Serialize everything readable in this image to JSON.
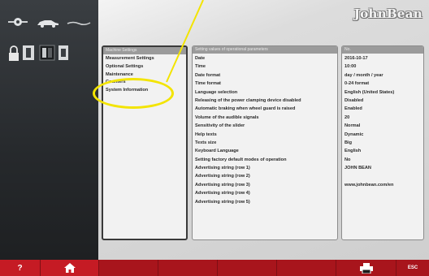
{
  "brand": {
    "logo_text": "JohnBean"
  },
  "menu": {
    "header": "Machine Settings",
    "items": [
      {
        "label": "Measurement Settings"
      },
      {
        "label": "Optional Settings"
      },
      {
        "label": "Maintenance"
      },
      {
        "label": "Counters"
      },
      {
        "label": "System Information"
      }
    ]
  },
  "params": {
    "header": "Setting values of operational parameters",
    "rows": [
      {
        "label": "Date",
        "value": "2016-10-17"
      },
      {
        "label": "Time",
        "value": "10:00"
      },
      {
        "label": "Date format",
        "value": "day / month / year"
      },
      {
        "label": "Time format",
        "value": "0-24 format"
      },
      {
        "label": "Language selection",
        "value": "English (United States)"
      },
      {
        "label": "Releasing of the power clamping device disabled",
        "value": "Disabled"
      },
      {
        "label": "Automatic braking when wheel guard is raised",
        "value": "Enabled"
      },
      {
        "label": "Volume of the audible signals",
        "value": "20"
      },
      {
        "label": "Sensitivity of the slider",
        "value": "Normal"
      },
      {
        "label": "Help texts",
        "value": "Dynamic"
      },
      {
        "label": "Texts size",
        "value": "Big"
      },
      {
        "label": "Keyboard Language",
        "value": "English"
      },
      {
        "label": "Setting factory default modes of operation",
        "value": "No"
      },
      {
        "label": "Advertising string (row 1)",
        "value": "JOHN BEAN"
      },
      {
        "label": "Advertising string (row 2)",
        "value": ""
      },
      {
        "label": "Advertising string (row 3)",
        "value": "www.johnbean.com/en"
      },
      {
        "label": "Advertising string (row 4)",
        "value": ""
      },
      {
        "label": "Advertising string (row 5)",
        "value": ""
      }
    ]
  },
  "values_panel": {
    "header": "No."
  },
  "bottom_bar": {
    "help_label": "?",
    "esc_label": "ESC"
  },
  "icons": {
    "sidebar": [
      "wheel-balance-icon",
      "car-icon",
      "straight-line-icon",
      "lock-icon",
      "gauge-icon",
      "gauge-pair-icon",
      "gauge-small-icon"
    ],
    "bottom": [
      "home-icon",
      "printer-icon"
    ]
  },
  "colors": {
    "accent_red": "#c51b24",
    "annotation_yellow": "#f3e400",
    "sidebar_dark": "#26292c"
  }
}
